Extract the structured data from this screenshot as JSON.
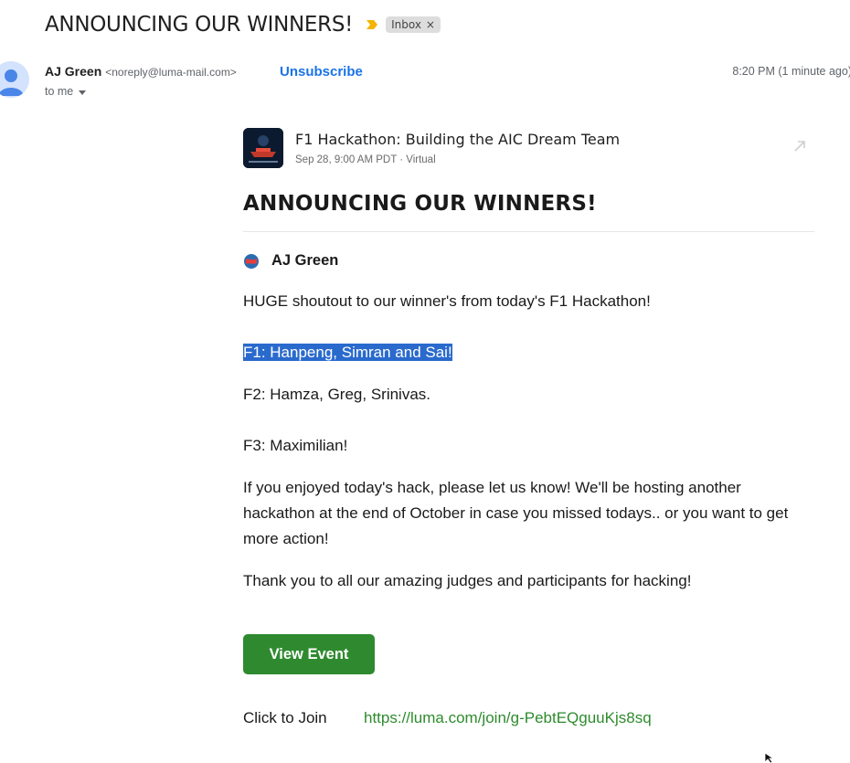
{
  "header": {
    "subject": "ANNOUNCING OUR WINNERS!",
    "label_chip": "Inbox",
    "chip_close": "×",
    "importance_color": "#f4b400"
  },
  "sender": {
    "name": "AJ Green",
    "email": "<noreply@luma-mail.com>",
    "unsubscribe": "Unsubscribe",
    "timestamp": "8:20 PM (1 minute ago)",
    "recipient": "to me"
  },
  "event": {
    "title": "F1 Hackathon: Building the AIC Dream Team",
    "meta": "Sep 28, 9:00 AM PDT · Virtual"
  },
  "message": {
    "heading": "ANNOUNCING OUR WINNERS!",
    "author": "AJ Green",
    "intro": "HUGE shoutout to our winner's from today's F1 Hackathon!",
    "first": "F1: Hanpeng, Simran and Sai!",
    "second": "F2: Hamza, Greg, Srinivas.",
    "third": "F3: Maximilian!",
    "followup": "If you enjoyed today's hack, please let us know! We'll be hosting another hackathon at the end of October in case you missed todays.. or you want to get more action!",
    "thanks": "Thank you to all our amazing judges and participants for hacking!",
    "button": "View Event",
    "join_label": "Click to Join",
    "join_link": "https://luma.com/join/g-PebtEQguuKjs8sq"
  },
  "colors": {
    "accent_blue": "#1a73e8",
    "highlight": "#2a6acd",
    "button_green": "#2f8a2f",
    "link_green": "#2e8b2e"
  }
}
